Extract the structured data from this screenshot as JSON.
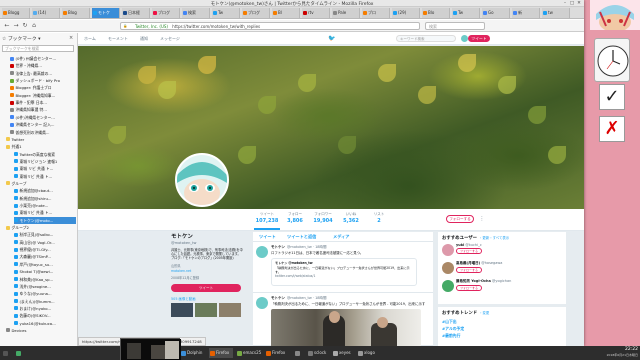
{
  "window": {
    "title": "モトケン(@motoken_tw)さん | Twitterから見たタイムライン - Mozilla Firefox",
    "controls": [
      "–",
      "□",
      "✕"
    ]
  },
  "tabs": [
    {
      "label": "Blogg",
      "color": "#f57d00"
    },
    {
      "label": "(14)",
      "color": "#55acee"
    },
    {
      "label": "Blog",
      "color": "#f57d00"
    },
    {
      "label": "モトケ",
      "color": "#1da1f2",
      "active": true
    },
    {
      "label": "日本経",
      "color": "#1a4b8c"
    },
    {
      "label": "ブログ",
      "color": "#e14"
    },
    {
      "label": "検索",
      "color": "#4285f4"
    },
    {
      "label": "Tw",
      "color": "#1da1f2"
    },
    {
      "label": "ブログ",
      "color": "#f57d00"
    },
    {
      "label": "Bl",
      "color": "#f57d00"
    },
    {
      "label": "rtv",
      "color": "#c00"
    },
    {
      "label": "Pale",
      "color": "#888"
    },
    {
      "label": "ブロ",
      "color": "#f57d00"
    },
    {
      "label": "(29)",
      "color": "#1da1f2"
    },
    {
      "label": "Blo",
      "color": "#f57d00"
    },
    {
      "label": "Tw",
      "color": "#1da1f2"
    },
    {
      "label": "Go",
      "color": "#4285f4"
    },
    {
      "label": "新",
      "color": "#4285f4"
    },
    {
      "label": "tw",
      "color": "#1da1f2"
    }
  ],
  "nav": {
    "back": "←",
    "forward": "→",
    "reload": "↻",
    "home": "⌂",
    "security": "Twitter, Inc. (US)",
    "url": "https://twitter.com/motoken_tw/with_replies",
    "search_placeholder": "検索"
  },
  "sidebar": {
    "title": "ブックマーク",
    "close": "×",
    "search_placeholder": "ブックマークを検索",
    "items": [
      {
        "label": "(0件) 州議会センター...",
        "color": "#4285f4",
        "indent": 4
      },
      {
        "label": "世界・沖縄県...",
        "color": "#c00",
        "indent": 4
      },
      {
        "label": "法律上告: 最高裁の...",
        "color": "#888",
        "indent": 4
      },
      {
        "label": "ダッシュボード · bify Pro",
        "color": "#6a3",
        "indent": 4
      },
      {
        "label": "Blogger: 弁護士ブロ",
        "color": "#f57d00",
        "indent": 4
      },
      {
        "label": "Blogger: 沖縄県知事...",
        "color": "#f57d00",
        "indent": 4
      },
      {
        "label": "事件・犯罪 日本...",
        "color": "#c00",
        "indent": 4
      },
      {
        "label": "沖縄県知事選 特...",
        "color": "#888",
        "indent": 4
      },
      {
        "label": "(0件)沖縄県センター...",
        "color": "#4285f4",
        "indent": 4
      },
      {
        "label": "沖縄県センター 記入...",
        "color": "#4285f4",
        "indent": 4
      },
      {
        "label": "仮想死刑の沖縄県...",
        "color": "#888",
        "indent": 4
      },
      {
        "label": "Twitter",
        "color": "#f2c94c",
        "indent": 2,
        "folder": true
      },
      {
        "label": "共通1",
        "color": "#f2c94c",
        "indent": 2,
        "folder": true
      },
      {
        "label": "Twitterの高度な検索",
        "color": "#1da1f2",
        "indent": 6
      },
      {
        "label": "東城リビジョン 速報1",
        "color": "#1da1f2",
        "indent": 6
      },
      {
        "label": "東城 リビ 共通 ト...",
        "color": "#1da1f2",
        "indent": 6
      },
      {
        "label": "東城リビ 共通 ト...",
        "color": "#1da1f2",
        "indent": 6
      },
      {
        "label": "グループ",
        "color": "#f2c94c",
        "indent": 2,
        "folder": true
      },
      {
        "label": "新規追加@cbaut...",
        "color": "#1da1f2",
        "indent": 6
      },
      {
        "label": "新規追加@shiru...",
        "color": "#1da1f2",
        "indent": 6
      },
      {
        "label": "小栗売(@note...",
        "color": "#1da1f2",
        "indent": 6
      },
      {
        "label": "東城リビ 共通 ト...",
        "color": "#1da1f2",
        "indent": 6
      },
      {
        "label": "モトケン(@moto...",
        "color": "#1da1f2",
        "indent": 6,
        "selected": true
      },
      {
        "label": "グループ2",
        "color": "#f2c94c",
        "indent": 2,
        "folder": true
      },
      {
        "label": "秋岸正見(@solko...",
        "color": "#1da1f2",
        "indent": 6
      },
      {
        "label": "高山谷(@ Vogl-Or...",
        "color": "#1da1f2",
        "indent": 6
      },
      {
        "label": "視界優(@TI-Gfy...",
        "color": "#1da1f2",
        "indent": 6
      },
      {
        "label": "大森麗(@TSimP...",
        "color": "#1da1f2",
        "indent": 6
      },
      {
        "label": "岸戸(@toyuc_su...",
        "color": "#1da1f2",
        "indent": 6
      },
      {
        "label": "Shokoi T(@aewi...",
        "color": "#1da1f2",
        "indent": 6
      },
      {
        "label": "林和美(@Kaa_sp...",
        "color": "#1da1f2",
        "indent": 6
      },
      {
        "label": "浅井(@seogine...",
        "color": "#1da1f2",
        "indent": 6
      },
      {
        "label": "ゆうな(@yuuna...",
        "color": "#1da1f2",
        "indent": 6
      },
      {
        "label": "(まえん)(@kumm...",
        "color": "#1da1f2",
        "indent": 6
      },
      {
        "label": "おまけ(@nyoko...",
        "color": "#1da1f2",
        "indent": 6
      },
      {
        "label": "佐藤の(@SiKOV...",
        "color": "#1da1f2",
        "indent": 6
      },
      {
        "label": "yuka16(@kukuca...",
        "color": "#1da1f2",
        "indent": 6
      },
      {
        "label": "Devices",
        "color": "#888",
        "indent": 2
      }
    ]
  },
  "twitter": {
    "nav": [
      "ホーム",
      "モーメント",
      "通知",
      "メッセージ"
    ],
    "search_placeholder": "キーワード検索",
    "tweet_button": "ツイート",
    "stats": [
      {
        "label": "ツイート",
        "value": "107,238"
      },
      {
        "label": "フォロー",
        "value": "3,806"
      },
      {
        "label": "フォロワー",
        "value": "19,904"
      },
      {
        "label": "いいね",
        "value": "5,362"
      },
      {
        "label": "リスト",
        "value": "2"
      }
    ],
    "follow": "フォローする",
    "more": "⋮",
    "profile": {
      "name": "モトケン",
      "handle": "@motoken_tw",
      "bio": "弁護士、元検事(東京地検)で、刑事司法(法務)を中心にした話題。元検事、東京で開業しています。ブログ:「モトケンのブログ」(2005年開設)",
      "location": "山形県",
      "link": "motoken.net",
      "joined": "2008年12月に登録",
      "tweet_to": "ツイート",
      "media_link": "505 画像と動画"
    },
    "timeline_tabs": [
      "ツイート",
      "ツイートと返信",
      "メディア"
    ],
    "tweets": [
      {
        "name": "モトケン",
        "handle": "@motoken_tw · 18時間",
        "text": "ロフトラジオ11日は、日本で著名度司法被疑に一応と見つ。",
        "card_title": "モトケン @motoken_tw",
        "card_text": "「執務判決が出るために、一日報道がない」プロデューサー免状さんが世界可能2019、出来に示す。",
        "card_url": "twitter.com/i/web/status/1"
      },
      {
        "name": "モトケン",
        "handle": "@motoken_tw · 18時間",
        "text": "「執務判決が出るために、一日報道がない」プロデューサー免状さんが世界 - 可能2019、出来に示す"
      }
    ],
    "suggestions_title": "おすすめユーザー",
    "suggestions_links": "・更新・すべて表示",
    "suggestions": [
      {
        "name": "yuki",
        "handle": "@kuchi_c",
        "follow": "フォローする",
        "color": "#d9a"
      },
      {
        "name": "高島義(月曜日)",
        "handle": "@hasegawa",
        "follow": "フォローする",
        "color": "#a86"
      },
      {
        "name": "藤島知男 Yogi-Ocha",
        "handle": "@yogichan",
        "follow": "フォローする",
        "color": "#4a6"
      }
    ],
    "trends_title": "おすすめトレンド",
    "trends_link": "・変更",
    "trends": [
      {
        "tag": "#山下出",
        "sub": "Promoted"
      },
      {
        "tag": "#アルの予定",
        "sub": "関連ツイート"
      },
      {
        "tag": "#最前先行",
        "sub": "トレンド"
      }
    ]
  },
  "status_url": "https://twitter.com/motoken_tw/status/1009771225309917248",
  "taskbar": {
    "items": [
      {
        "label": "",
        "color": "#555"
      },
      {
        "label": "",
        "color": "#4a6"
      },
      {
        "label": "アラーム",
        "color": "#c44"
      },
      {
        "label": "Dolphin",
        "color": "#3b8ed8"
      },
      {
        "label": "Firefox",
        "color": "#e66000",
        "active": true
      },
      {
        "label": "emacs25",
        "color": "#7a4"
      },
      {
        "label": "Firefox",
        "color": "#e66000"
      },
      {
        "label": "",
        "color": "#888"
      },
      {
        "label": "sclock",
        "color": "#777"
      },
      {
        "label": "xeyes",
        "color": "#aaa"
      },
      {
        "label": "xlogo",
        "color": "#999"
      }
    ],
    "time": "22:22",
    "date": "2018年6月21日木曜日"
  },
  "marks": [
    "✓",
    "✗"
  ]
}
